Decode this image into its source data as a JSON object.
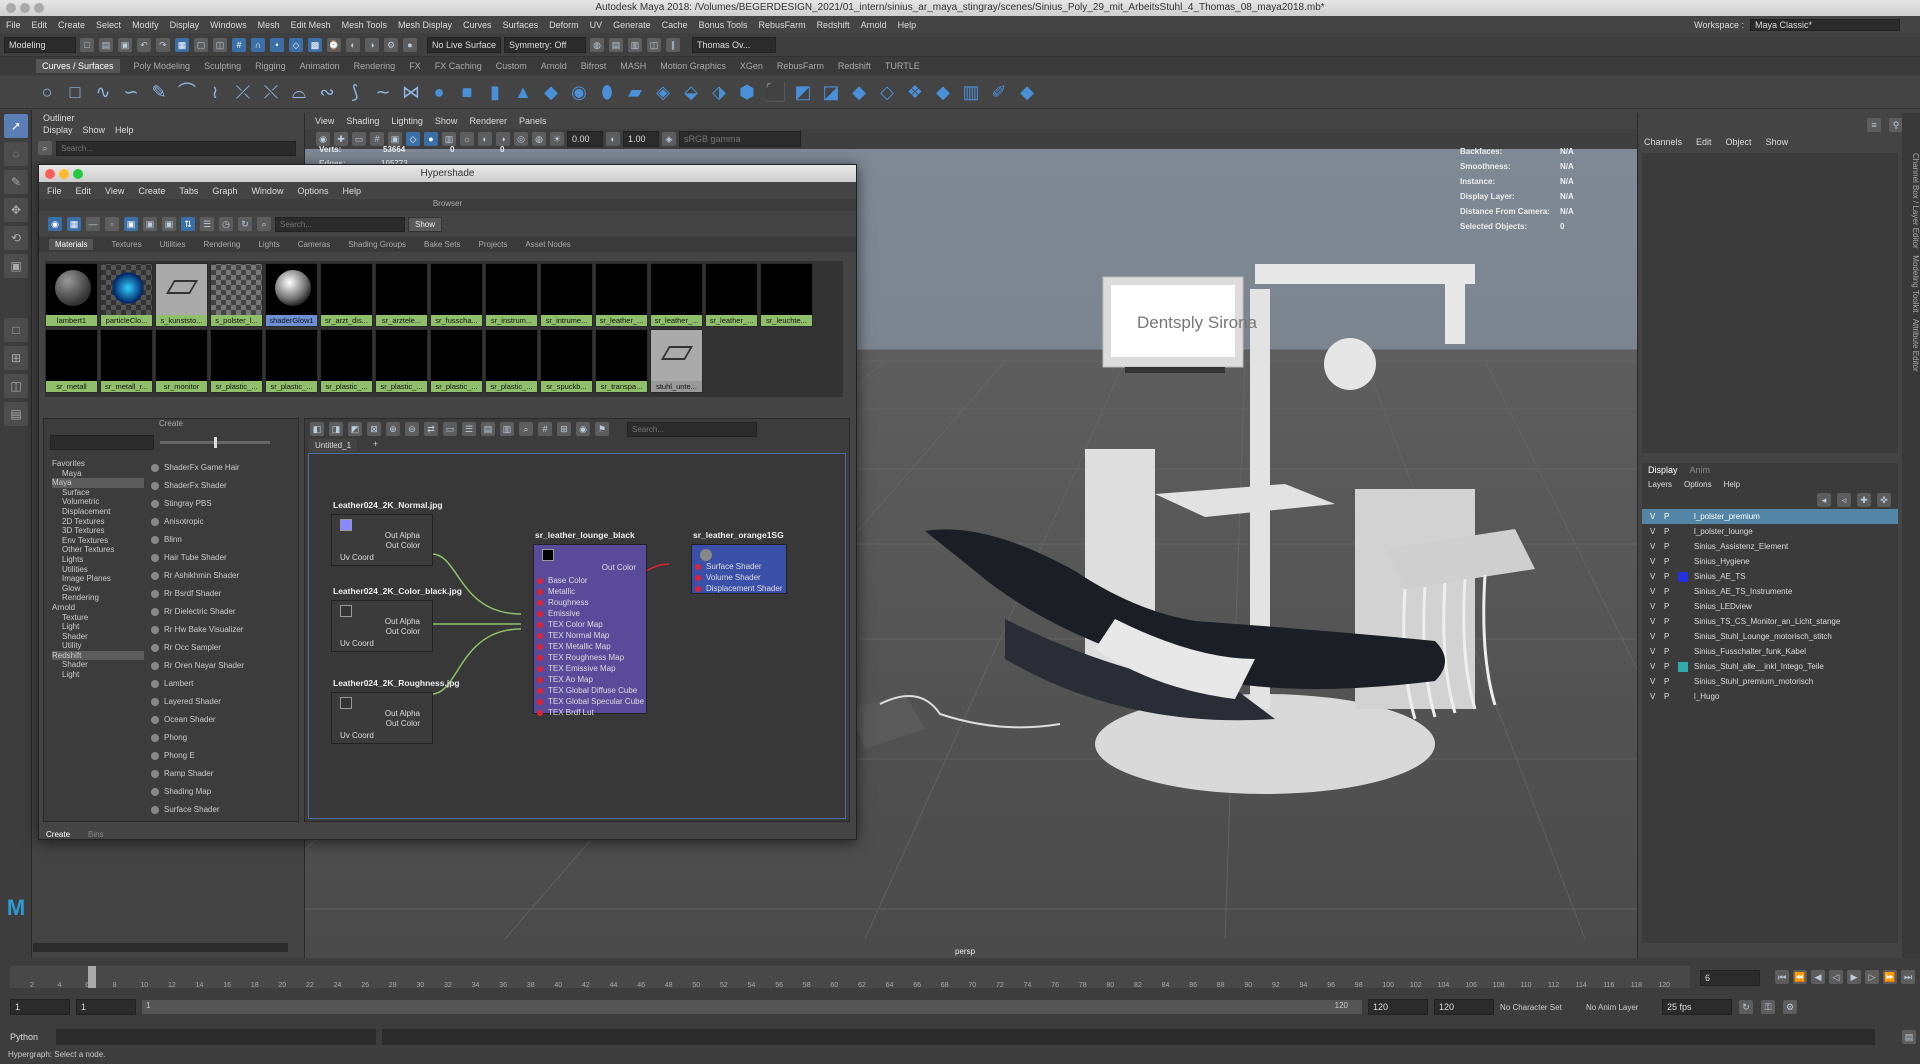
{
  "window": {
    "title": "Autodesk Maya 2018: /Volumes/BEGERDESIGN_2021/01_intern/sinius_ar_maya_stingray/scenes/Sinius_Poly_29_mit_ArbeitsStuhl_4_Thomas_08_maya2018.mb*"
  },
  "menus": [
    "File",
    "Edit",
    "Create",
    "Select",
    "Modify",
    "Display",
    "Windows",
    "Mesh",
    "Edit Mesh",
    "Mesh Tools",
    "Mesh Display",
    "Curves",
    "Surfaces",
    "Deform",
    "UV",
    "Generate",
    "Cache",
    "Bonus Tools",
    "RebusFarm",
    "Redshift",
    "Arnold",
    "Help"
  ],
  "workspace": {
    "label": "Workspace :",
    "value": "Maya Classic*"
  },
  "statusline": {
    "mode": "Modeling",
    "live_surface": "No Live Surface",
    "symmetry": "Symmetry: Off",
    "user": "Thomas Ov..."
  },
  "shelf_tabs": [
    "Curves / Surfaces",
    "Poly Modeling",
    "Sculpting",
    "Rigging",
    "Animation",
    "Rendering",
    "FX",
    "FX Caching",
    "Custom",
    "Arnold",
    "Bifrost",
    "MASH",
    "Motion Graphics",
    "XGen",
    "RebusFarm",
    "Redshift",
    "TURTLE"
  ],
  "outliner": {
    "title": "Outliner",
    "menus": [
      "Display",
      "Show",
      "Help"
    ],
    "search": "Search..."
  },
  "viewport": {
    "menus": [
      "View",
      "Shading",
      "Lighting",
      "Show",
      "Renderer",
      "Panels"
    ],
    "verts_label": "Verts:",
    "verts_value": "53664",
    "verts_a": "0",
    "verts_b": "0",
    "edges_label": "Edges:",
    "edges_value": "105773",
    "camera": "persp",
    "field_a": "0.00",
    "field_b": "1.00",
    "cam_combo": "sRGB gamma",
    "brand": "Dentsply Sirona"
  },
  "hud": [
    {
      "label": "Backfaces:",
      "value": "N/A"
    },
    {
      "label": "Smoothness:",
      "value": "N/A"
    },
    {
      "label": "Instance:",
      "value": "N/A"
    },
    {
      "label": "Display Layer:",
      "value": "N/A"
    },
    {
      "label": "Distance From Camera:",
      "value": "N/A"
    },
    {
      "label": "Selected Objects:",
      "value": "0"
    }
  ],
  "hypershade": {
    "title": "Hypershade",
    "menus": [
      "File",
      "Edit",
      "View",
      "Create",
      "Tabs",
      "Graph",
      "Window",
      "Options",
      "Help"
    ],
    "browser_title": "Browser",
    "search": "Search...",
    "show_button": "Show",
    "tabs": [
      "Materials",
      "Textures",
      "Utilities",
      "Rendering",
      "Lights",
      "Cameras",
      "Shading Groups",
      "Bake Sets",
      "Projects",
      "Asset Nodes"
    ],
    "row1": [
      "lambert1",
      "particleClo...",
      "s_kunststo...",
      "s_polster_l...",
      "shaderGlow1",
      "sr_arzt_dis...",
      "sr_arztele...",
      "sr_fusscha...",
      "sr_instrum...",
      "sr_intrume...",
      "sr_leather_...",
      "sr_leather_...",
      "sr_leather_...",
      "sr_leuchte..."
    ],
    "row2": [
      "sr_metall",
      "sr_metall_r...",
      "sr_monitor",
      "sr_plastic_...",
      "sr_plastic_...",
      "sr_plastic_...",
      "sr_plastic_...",
      "sr_plastic_...",
      "sr_plastic_...",
      "sr_spuckb...",
      "sr_transpa...",
      "stuhl_unte..."
    ],
    "create_title": "Create",
    "create_tabs": [
      "Create",
      "Bins"
    ],
    "tree": [
      "Favorites",
      "Maya",
      "Maya",
      "Surface",
      "Volumetric",
      "Displacement",
      "2D Textures",
      "3D Textures",
      "Env Textures",
      "Other Textures",
      "Lights",
      "Utilities",
      "Image Planes",
      "Glow",
      "Rendering",
      "Arnold",
      "Texture",
      "Light",
      "Shader",
      "Utility",
      "Redshift",
      "Shader",
      "Light"
    ],
    "shaders": [
      "ShaderFx Game Hair",
      "ShaderFx Shader",
      "Stingray PBS",
      "Anisotropic",
      "Blinn",
      "Hair Tube Shader",
      "Rr Ashikhmin Shader",
      "Rr Bsrdf Shader",
      "Rr Dielectric Shader",
      "Rr Hw Bake Visualizer",
      "Rr Occ Sampler",
      "Rr Oren Nayar Shader",
      "Lambert",
      "Layered Shader",
      "Ocean Shader",
      "Phong",
      "Phong E",
      "Ramp Shader",
      "Shading Map",
      "Surface Shader"
    ],
    "graph_tab": "Untitled_1",
    "graph_search": "Search...",
    "nodes": {
      "n1": "Leather024_2K_Normal.jpg",
      "n2": "Leather024_2K_Color_black.jpg",
      "n3": "Leather024_2K_Roughness.jpg",
      "out_alpha": "Out Alpha",
      "out_color": "Out Color",
      "uv": "Uv Coord",
      "sr": "sr_leather_lounge_black",
      "sg": "sr_leather_orange1SG",
      "sr_out": "Out Color",
      "sr_ports": [
        "Base Color",
        "Metallic",
        "Roughness",
        "Emissive",
        "TEX Color Map",
        "TEX Normal Map",
        "TEX Metallic Map",
        "TEX Roughness Map",
        "TEX Emissive Map",
        "TEX Ao Map",
        "TEX Global Diffuse Cube",
        "TEX Global Specular Cube",
        "TEX Brdf Lut"
      ],
      "sg_ports": [
        "Surface Shader",
        "Volume Shader",
        "Displacement Shader"
      ]
    }
  },
  "channelbox": {
    "menus": [
      "Channels",
      "Edit",
      "Object",
      "Show"
    ]
  },
  "layers": {
    "tabs": [
      "Display",
      "Anim"
    ],
    "menus": [
      "Layers",
      "Options",
      "Help"
    ],
    "items": [
      "l_polster_premium",
      "l_polster_lounge",
      "Sinius_Assistenz_Element",
      "Sinius_Hygiene",
      "Sinius_AE_TS",
      "Sinius_AE_TS_Instrumente",
      "Sinius_LEDview",
      "Sinius_TS_CS_Monitor_an_Licht_stange",
      "Sinius_Stuhl_Lounge_motorisch_stitch",
      "Sinius_Fusschalter_funk_Kabel",
      "Sinius_Stuhl_alle__inkl_Intego_Teile",
      "Sinius_Stuhl_premium_motorisch",
      "l_Hugo"
    ],
    "v": "V",
    "p": "P"
  },
  "timeline": {
    "ticks": [
      "2",
      "4",
      "6",
      "8",
      "10",
      "12",
      "14",
      "16",
      "18",
      "20",
      "22",
      "24",
      "26",
      "28",
      "30",
      "32",
      "34",
      "36",
      "38",
      "40",
      "42",
      "44",
      "46",
      "48",
      "50",
      "52",
      "54",
      "56",
      "58",
      "60",
      "62",
      "64",
      "66",
      "68",
      "70",
      "72",
      "74",
      "76",
      "78",
      "80",
      "82",
      "84",
      "86",
      "88",
      "90",
      "92",
      "94",
      "96",
      "98",
      "100",
      "102",
      "104",
      "106",
      "108",
      "110",
      "112",
      "114",
      "116",
      "118",
      "120"
    ],
    "current": "6",
    "current_box": "6",
    "start": "1",
    "start2": "1",
    "range_start": "1",
    "range_end": "120",
    "end": "120",
    "end2": "120",
    "char_set": "No Character Set",
    "anim_layer": "No Anim Layer",
    "fps": "25 fps"
  },
  "python": {
    "label": "Python"
  },
  "help_line": "Hypergraph: Select a node."
}
